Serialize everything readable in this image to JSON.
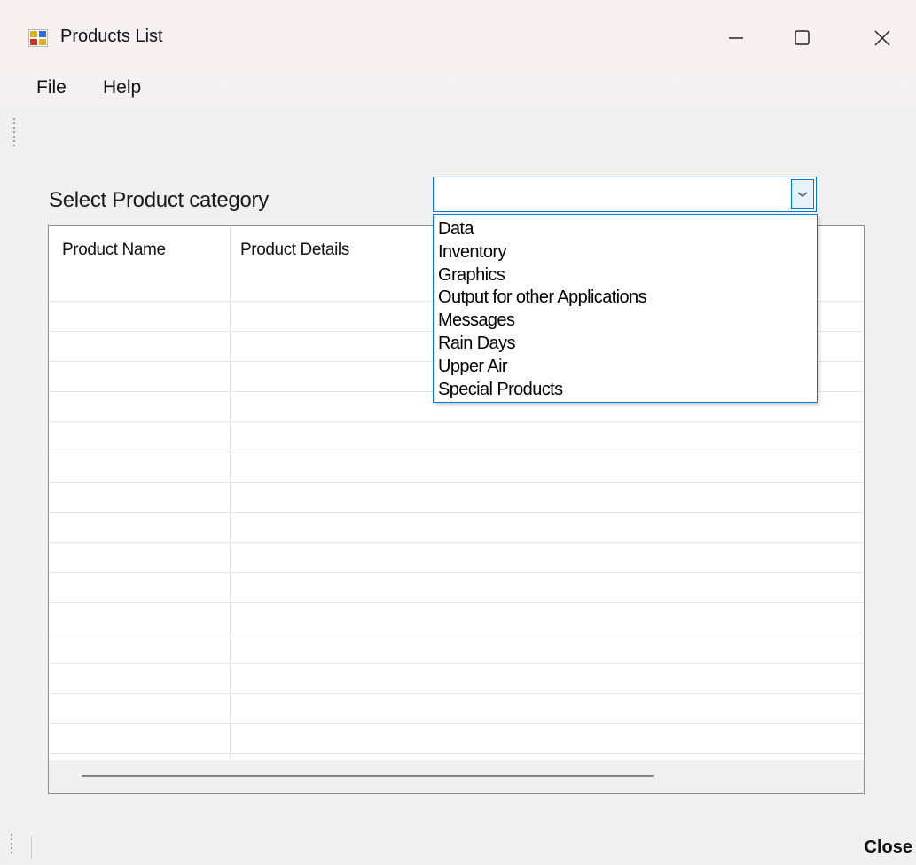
{
  "window": {
    "title": "Products List"
  },
  "menu": {
    "items": [
      "File",
      "Help"
    ]
  },
  "form": {
    "category_label": "Select Product category",
    "category_value": "",
    "category_options": [
      "Data",
      "Inventory",
      "Graphics",
      "Output for other Applications",
      "Messages",
      "Rain Days",
      "Upper Air",
      "Special Products"
    ]
  },
  "grid": {
    "columns": [
      "Product Name",
      "Product Details"
    ],
    "rows": []
  },
  "status": {
    "close_label": "Close"
  },
  "colors": {
    "accent": "#0078d7",
    "titlebar": "#f8f0ee",
    "window_bg": "#f0f0f0"
  },
  "icons": {
    "app": "app-icon",
    "minimize": "minimize-icon",
    "maximize": "maximize-icon",
    "close": "close-icon",
    "dropdown": "chevron-down-icon"
  }
}
